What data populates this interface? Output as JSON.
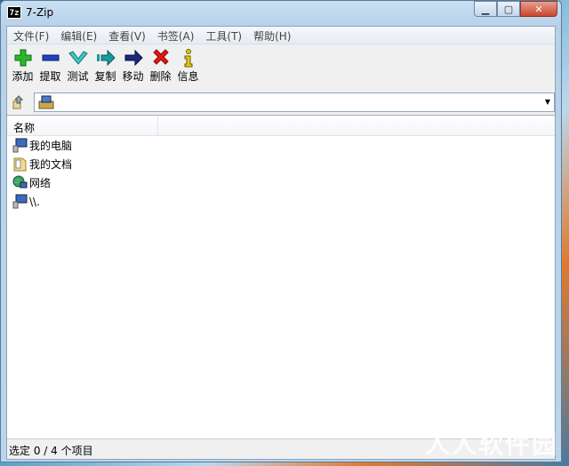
{
  "window": {
    "title": "7-Zip",
    "icon_text": "7z"
  },
  "menu": [
    {
      "label": "文件(F)"
    },
    {
      "label": "编辑(E)"
    },
    {
      "label": "查看(V)"
    },
    {
      "label": "书签(A)"
    },
    {
      "label": "工具(T)"
    },
    {
      "label": "帮助(H)"
    }
  ],
  "toolbar": [
    {
      "label": "添加",
      "icon": "plus-icon"
    },
    {
      "label": "提取",
      "icon": "minus-icon"
    },
    {
      "label": "测试",
      "icon": "check-icon"
    },
    {
      "label": "复制",
      "icon": "copy-arrow-icon"
    },
    {
      "label": "移动",
      "icon": "move-arrow-icon"
    },
    {
      "label": "删除",
      "icon": "delete-x-icon"
    },
    {
      "label": "信息",
      "icon": "info-icon"
    }
  ],
  "list": {
    "column": "名称",
    "items": [
      {
        "name": "我的电脑",
        "icon": "computer-icon"
      },
      {
        "name": "我的文档",
        "icon": "documents-folder-icon"
      },
      {
        "name": "网络",
        "icon": "network-icon"
      },
      {
        "name": "\\\\.",
        "icon": "computer-icon"
      }
    ]
  },
  "status": "选定 0 / 4 个项目",
  "watermark": "人人软件园"
}
